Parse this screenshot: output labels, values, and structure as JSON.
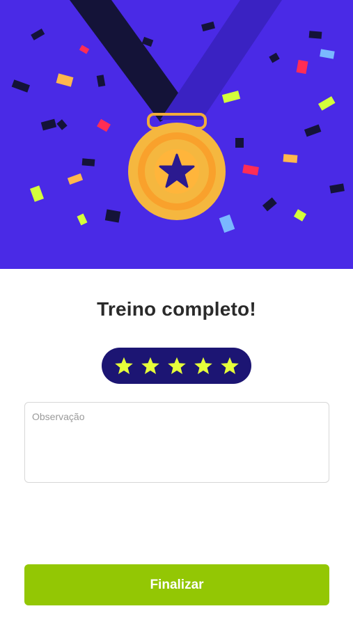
{
  "hero": {
    "background": "#4a2ae6",
    "medal_icon": "medal-icon",
    "medal_star_icon": "star-icon"
  },
  "title": "Treino completo!",
  "rating": {
    "value": 5,
    "max": 5,
    "star_color": "#e6ff3a",
    "pill_color": "#1c1573"
  },
  "observation": {
    "placeholder": "Observação",
    "value": ""
  },
  "finish_button": {
    "label": "Finalizar",
    "color": "#93c704"
  }
}
